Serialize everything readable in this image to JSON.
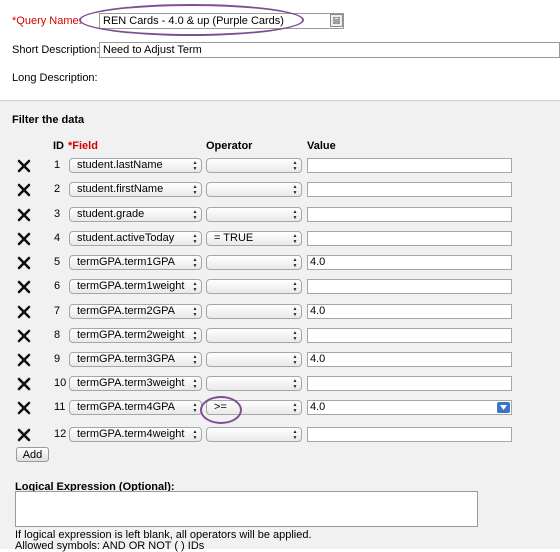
{
  "query": {
    "name_label": "*Query Name:",
    "name_value": "REN Cards - 4.0 & up (Purple Cards)",
    "short_label": "Short Description:",
    "short_value": "Need to Adjust Term",
    "long_label": "Long Description:"
  },
  "filter": {
    "title": "Filter the data",
    "headers": {
      "id": "ID",
      "field": "*Field",
      "operator": "Operator",
      "value": "Value"
    },
    "rows": [
      {
        "id": "1",
        "field": "student.lastName",
        "operator": "",
        "value": ""
      },
      {
        "id": "2",
        "field": "student.firstName",
        "operator": "",
        "value": ""
      },
      {
        "id": "3",
        "field": "student.grade",
        "operator": "",
        "value": ""
      },
      {
        "id": "4",
        "field": "student.activeToday",
        "operator": "= TRUE",
        "value": ""
      },
      {
        "id": "5",
        "field": "termGPA.term1GPA",
        "operator": "",
        "value": "4.0"
      },
      {
        "id": "6",
        "field": "termGPA.term1weight",
        "operator": "",
        "value": ""
      },
      {
        "id": "7",
        "field": "termGPA.term2GPA",
        "operator": "",
        "value": "4.0"
      },
      {
        "id": "8",
        "field": "termGPA.term2weight",
        "operator": "",
        "value": ""
      },
      {
        "id": "9",
        "field": "termGPA.term3GPA",
        "operator": "",
        "value": "4.0"
      },
      {
        "id": "10",
        "field": "termGPA.term3weight",
        "operator": "",
        "value": ""
      },
      {
        "id": "11",
        "field": "termGPA.term4GPA",
        "operator": ">=",
        "value": "4.0"
      },
      {
        "id": "12",
        "field": "termGPA.term4weight",
        "operator": "",
        "value": ""
      }
    ],
    "add_label": "Add"
  },
  "logical": {
    "title": "Logical Expression (Optional):",
    "value": "",
    "help_line1": "If logical expression is left blank, all operators will be applied.",
    "help_line2": "Allowed symbols: AND OR NOT ( ) IDs"
  },
  "icons": {
    "delete": "x-delete-icon",
    "lookup": "lookup-icon",
    "dropdown": "dropdown-arrow-icon"
  },
  "colors": {
    "required": "#d40000",
    "annotation": "#7e4f93",
    "accent": "#3c74c9"
  }
}
